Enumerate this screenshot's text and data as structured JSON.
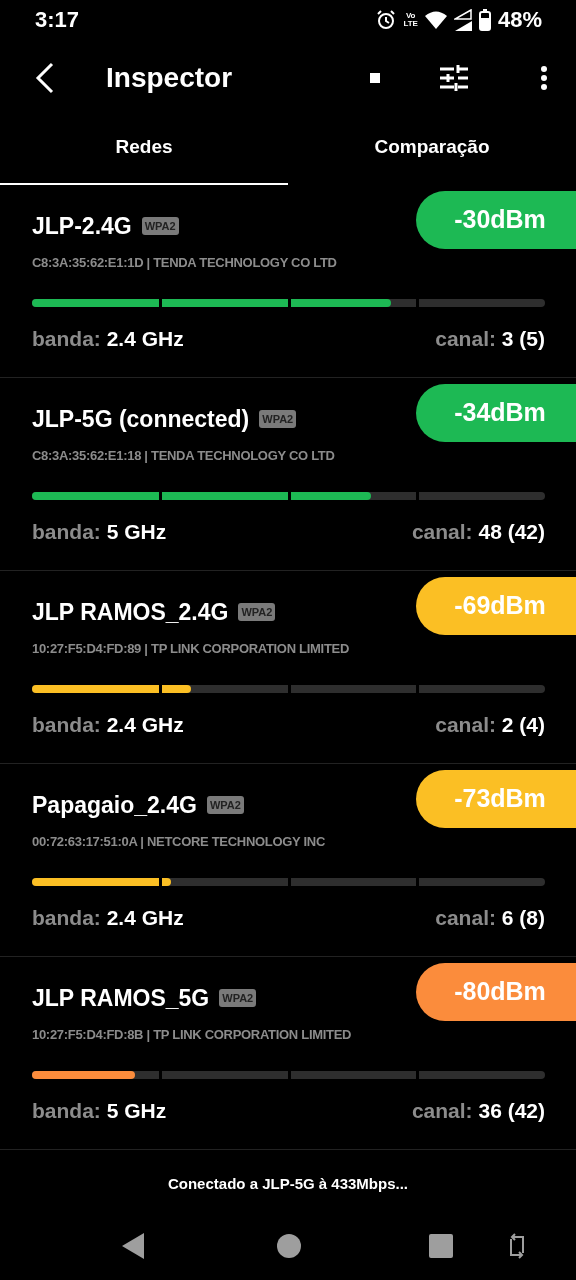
{
  "status_bar": {
    "time": "3:17",
    "volte": [
      "Vo",
      "LTE"
    ],
    "battery": "48%"
  },
  "toolbar": {
    "title": "Inspector"
  },
  "tabs": [
    {
      "label": "Redes",
      "selected": true
    },
    {
      "label": "Comparação",
      "selected": false
    }
  ],
  "networks": [
    {
      "ssid": "JLP-2.4G",
      "security": "WPA2",
      "details": "C8:3A:35:62:E1:1D  | TENDA TECHNOLOGY CO LTD",
      "signal": "-30dBm",
      "color": "#1db954",
      "level": 0.7,
      "band_label": "banda:",
      "band": "2.4 GHz",
      "channel_label": "canal:",
      "channel": "3 (5)"
    },
    {
      "ssid": "JLP-5G (connected)",
      "security": "WPA2",
      "details": "C8:3A:35:62:E1:18  | TENDA TECHNOLOGY CO LTD",
      "signal": "-34dBm",
      "color": "#1db954",
      "level": 0.66,
      "band_label": "banda:",
      "band": "5 GHz",
      "channel_label": "canal:",
      "channel": "48 (42)"
    },
    {
      "ssid": "JLP RAMOS_2.4G",
      "security": "WPA2",
      "details": "10:27:F5:D4:FD:89  | TP LINK CORPORATION LIMITED",
      "signal": "-69dBm",
      "color": "#fbbf24",
      "level": 0.31,
      "band_label": "banda:",
      "band": "2.4 GHz",
      "channel_label": "canal:",
      "channel": "2 (4)"
    },
    {
      "ssid": "Papagaio_2.4G",
      "security": "WPA2",
      "details": "00:72:63:17:51:0A  | NETCORE TECHNOLOGY INC",
      "signal": "-73dBm",
      "color": "#fbbf24",
      "level": 0.27,
      "band_label": "banda:",
      "band": "2.4 GHz",
      "channel_label": "canal:",
      "channel": "6 (8)"
    },
    {
      "ssid": "JLP RAMOS_5G",
      "security": "WPA2",
      "details": "10:27:F5:D4:FD:8B  | TP LINK CORPORATION LIMITED",
      "signal": "-80dBm",
      "color": "#fb8c3c",
      "level": 0.2,
      "band_label": "banda:",
      "band": "5 GHz",
      "channel_label": "canal:",
      "channel": "36 (42)"
    }
  ],
  "footer": {
    "message": "Conectado a JLP-5G à 433Mbps..."
  }
}
